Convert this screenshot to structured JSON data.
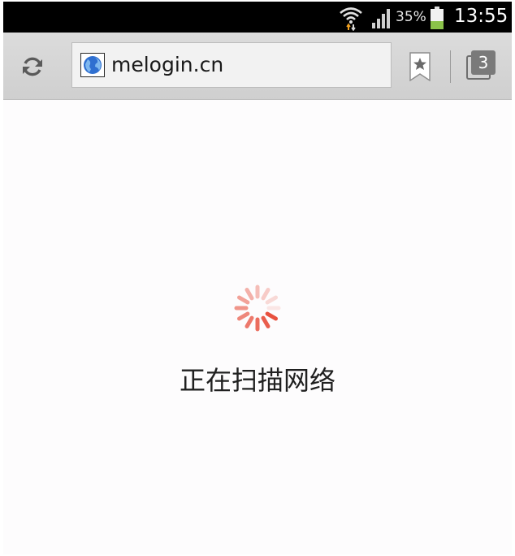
{
  "status_bar": {
    "battery_percent": "35%",
    "time": "13:55",
    "icons": [
      "wifi-icon",
      "signal-icon",
      "battery-icon"
    ]
  },
  "toolbar": {
    "url": "melogin.cn",
    "tab_count": "3",
    "icons": [
      "refresh-icon",
      "globe-icon",
      "bookmark-icon",
      "tabs-icon"
    ]
  },
  "page": {
    "loading_text": "正在扫描网络",
    "spinner_color": "#e8513f"
  }
}
